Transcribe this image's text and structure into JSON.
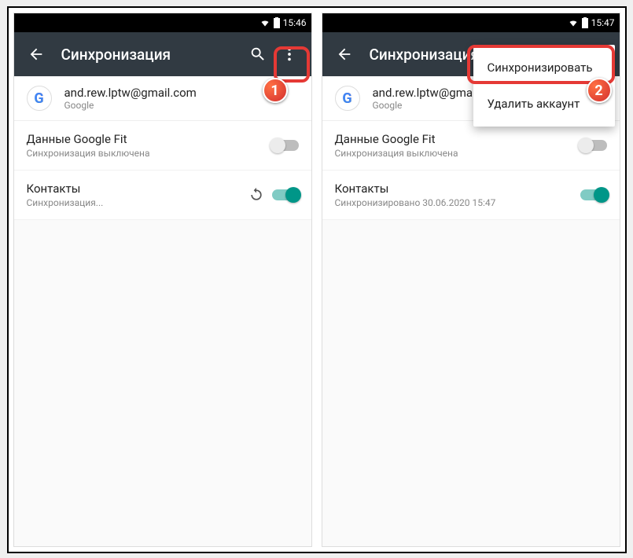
{
  "colors": {
    "accent": "#009688",
    "appbar": "#313a42",
    "callout": "#e53935"
  },
  "left": {
    "status": {
      "time": "15:46"
    },
    "appbar": {
      "title": "Синхронизация"
    },
    "account": {
      "email": "and.rew.lptw@gmail.com",
      "provider": "Google"
    },
    "items": [
      {
        "name": "Данные Google Fit",
        "sub": "Синхронизация выключена",
        "on": false,
        "syncing": false
      },
      {
        "name": "Контакты",
        "sub": "Синхронизация...",
        "on": true,
        "syncing": true
      }
    ],
    "callout_badge": "1"
  },
  "right": {
    "status": {
      "time": "15:47"
    },
    "appbar": {
      "title": "Синхронизация"
    },
    "account": {
      "email": "and.rew.lptw@gmail.com",
      "provider": "Google"
    },
    "items": [
      {
        "name": "Данные Google Fit",
        "sub": "Синхронизация выключена",
        "on": false,
        "syncing": false
      },
      {
        "name": "Контакты",
        "sub": "Синхронизировано 30.06.2020 15:47",
        "on": true,
        "syncing": false
      }
    ],
    "menu": {
      "sync": "Синхронизировать",
      "delete": "Удалить аккаунт"
    },
    "callout_badge": "2"
  }
}
